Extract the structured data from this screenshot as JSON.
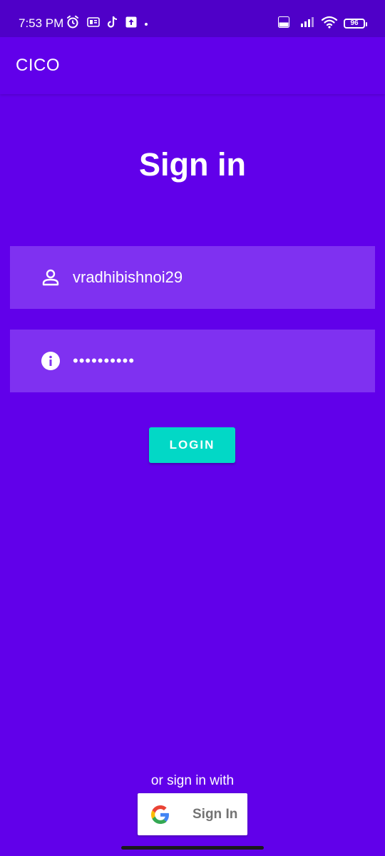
{
  "status_bar": {
    "time": "7:53 PM",
    "battery": "96",
    "network": "4G",
    "volte": "Vo LTE",
    "left_icons": [
      "alarm-icon",
      "message-icon",
      "tiktok-icon",
      "upload-icon",
      "dot-icon"
    ],
    "right_icons": [
      "volte-icon",
      "signal-icon",
      "wifi-icon",
      "battery-icon"
    ]
  },
  "app_bar": {
    "title": "CICO"
  },
  "signin": {
    "title": "Sign in",
    "username_value": "vradhibishnoi29",
    "username_icon": "person-icon",
    "password_value": "••••••••••",
    "password_icon": "info-icon",
    "login_label": "LOGIN",
    "alt_text": "or sign in with",
    "google_label": "Sign In",
    "google_icon": "google-icon"
  },
  "colors": {
    "background": "#6100ea",
    "status_bar": "#4f00c8",
    "field": "#7f31f1",
    "login_button": "#02d8c6",
    "google_button": "#ffffff",
    "google_text": "#737373"
  }
}
